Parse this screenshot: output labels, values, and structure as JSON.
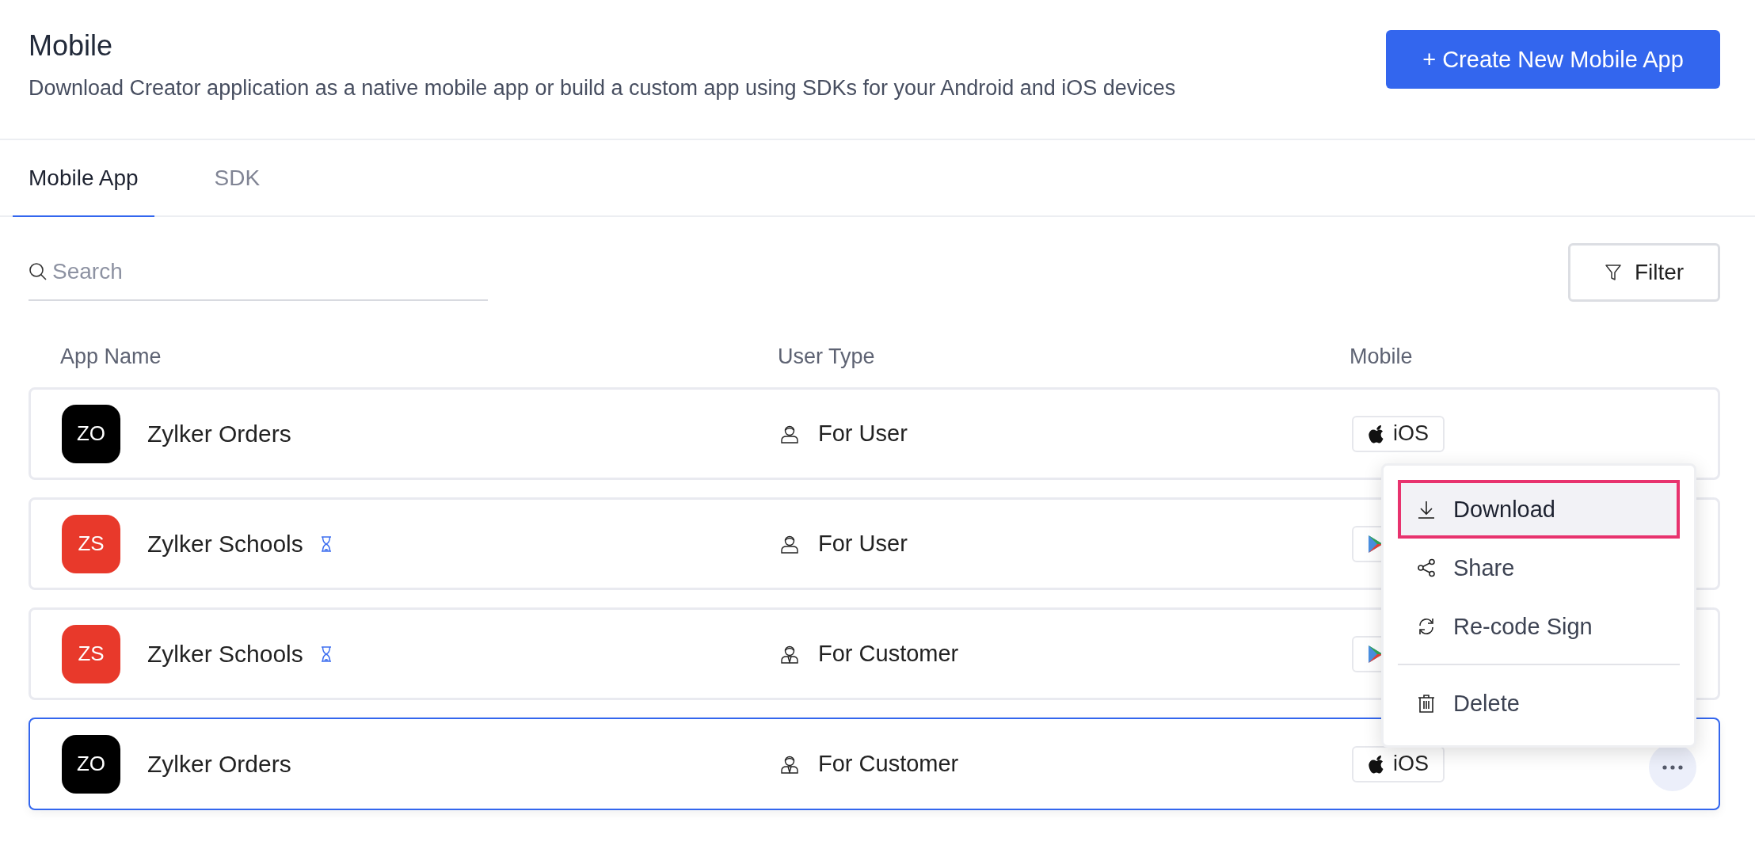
{
  "header": {
    "title": "Mobile",
    "subtitle": "Download Creator application as a native mobile app or build a custom app using SDKs for your Android and iOS devices",
    "create_button": "+ Create New Mobile App"
  },
  "tabs": [
    {
      "label": "Mobile App",
      "selected": true
    },
    {
      "label": "SDK",
      "selected": false
    }
  ],
  "search": {
    "placeholder": "Search"
  },
  "filter_button": "Filter",
  "table": {
    "columns": [
      "App Name",
      "User Type",
      "Mobile"
    ],
    "rows": [
      {
        "initials": "ZO",
        "color": "#000000",
        "name": "Zylker Orders",
        "pending": false,
        "user_type": {
          "kind": "user",
          "label": "For User"
        },
        "platform": {
          "kind": "ios",
          "label": "iOS"
        },
        "selected": false,
        "menu_button": false
      },
      {
        "initials": "ZS",
        "color": "#e8392b",
        "name": "Zylker Schools",
        "pending": true,
        "user_type": {
          "kind": "user",
          "label": "For User"
        },
        "platform": {
          "kind": "android"
        },
        "selected": false,
        "menu_button": false
      },
      {
        "initials": "ZS",
        "color": "#e8392b",
        "name": "Zylker Schools",
        "pending": true,
        "user_type": {
          "kind": "customer",
          "label": "For Customer"
        },
        "platform": {
          "kind": "android"
        },
        "selected": false,
        "menu_button": false
      },
      {
        "initials": "ZO",
        "color": "#000000",
        "name": "Zylker Orders",
        "pending": false,
        "user_type": {
          "kind": "customer",
          "label": "For Customer"
        },
        "platform": {
          "kind": "ios",
          "label": "iOS"
        },
        "selected": true,
        "menu_button": true
      }
    ]
  },
  "context_menu": {
    "items": [
      {
        "kind": "download",
        "label": "Download",
        "selected": true
      },
      {
        "kind": "share",
        "label": "Share",
        "selected": false
      },
      {
        "kind": "recode",
        "label": "Re-code Sign",
        "selected": false
      },
      {
        "kind": "delete",
        "label": "Delete",
        "selected": false,
        "divider_before": true
      }
    ]
  }
}
